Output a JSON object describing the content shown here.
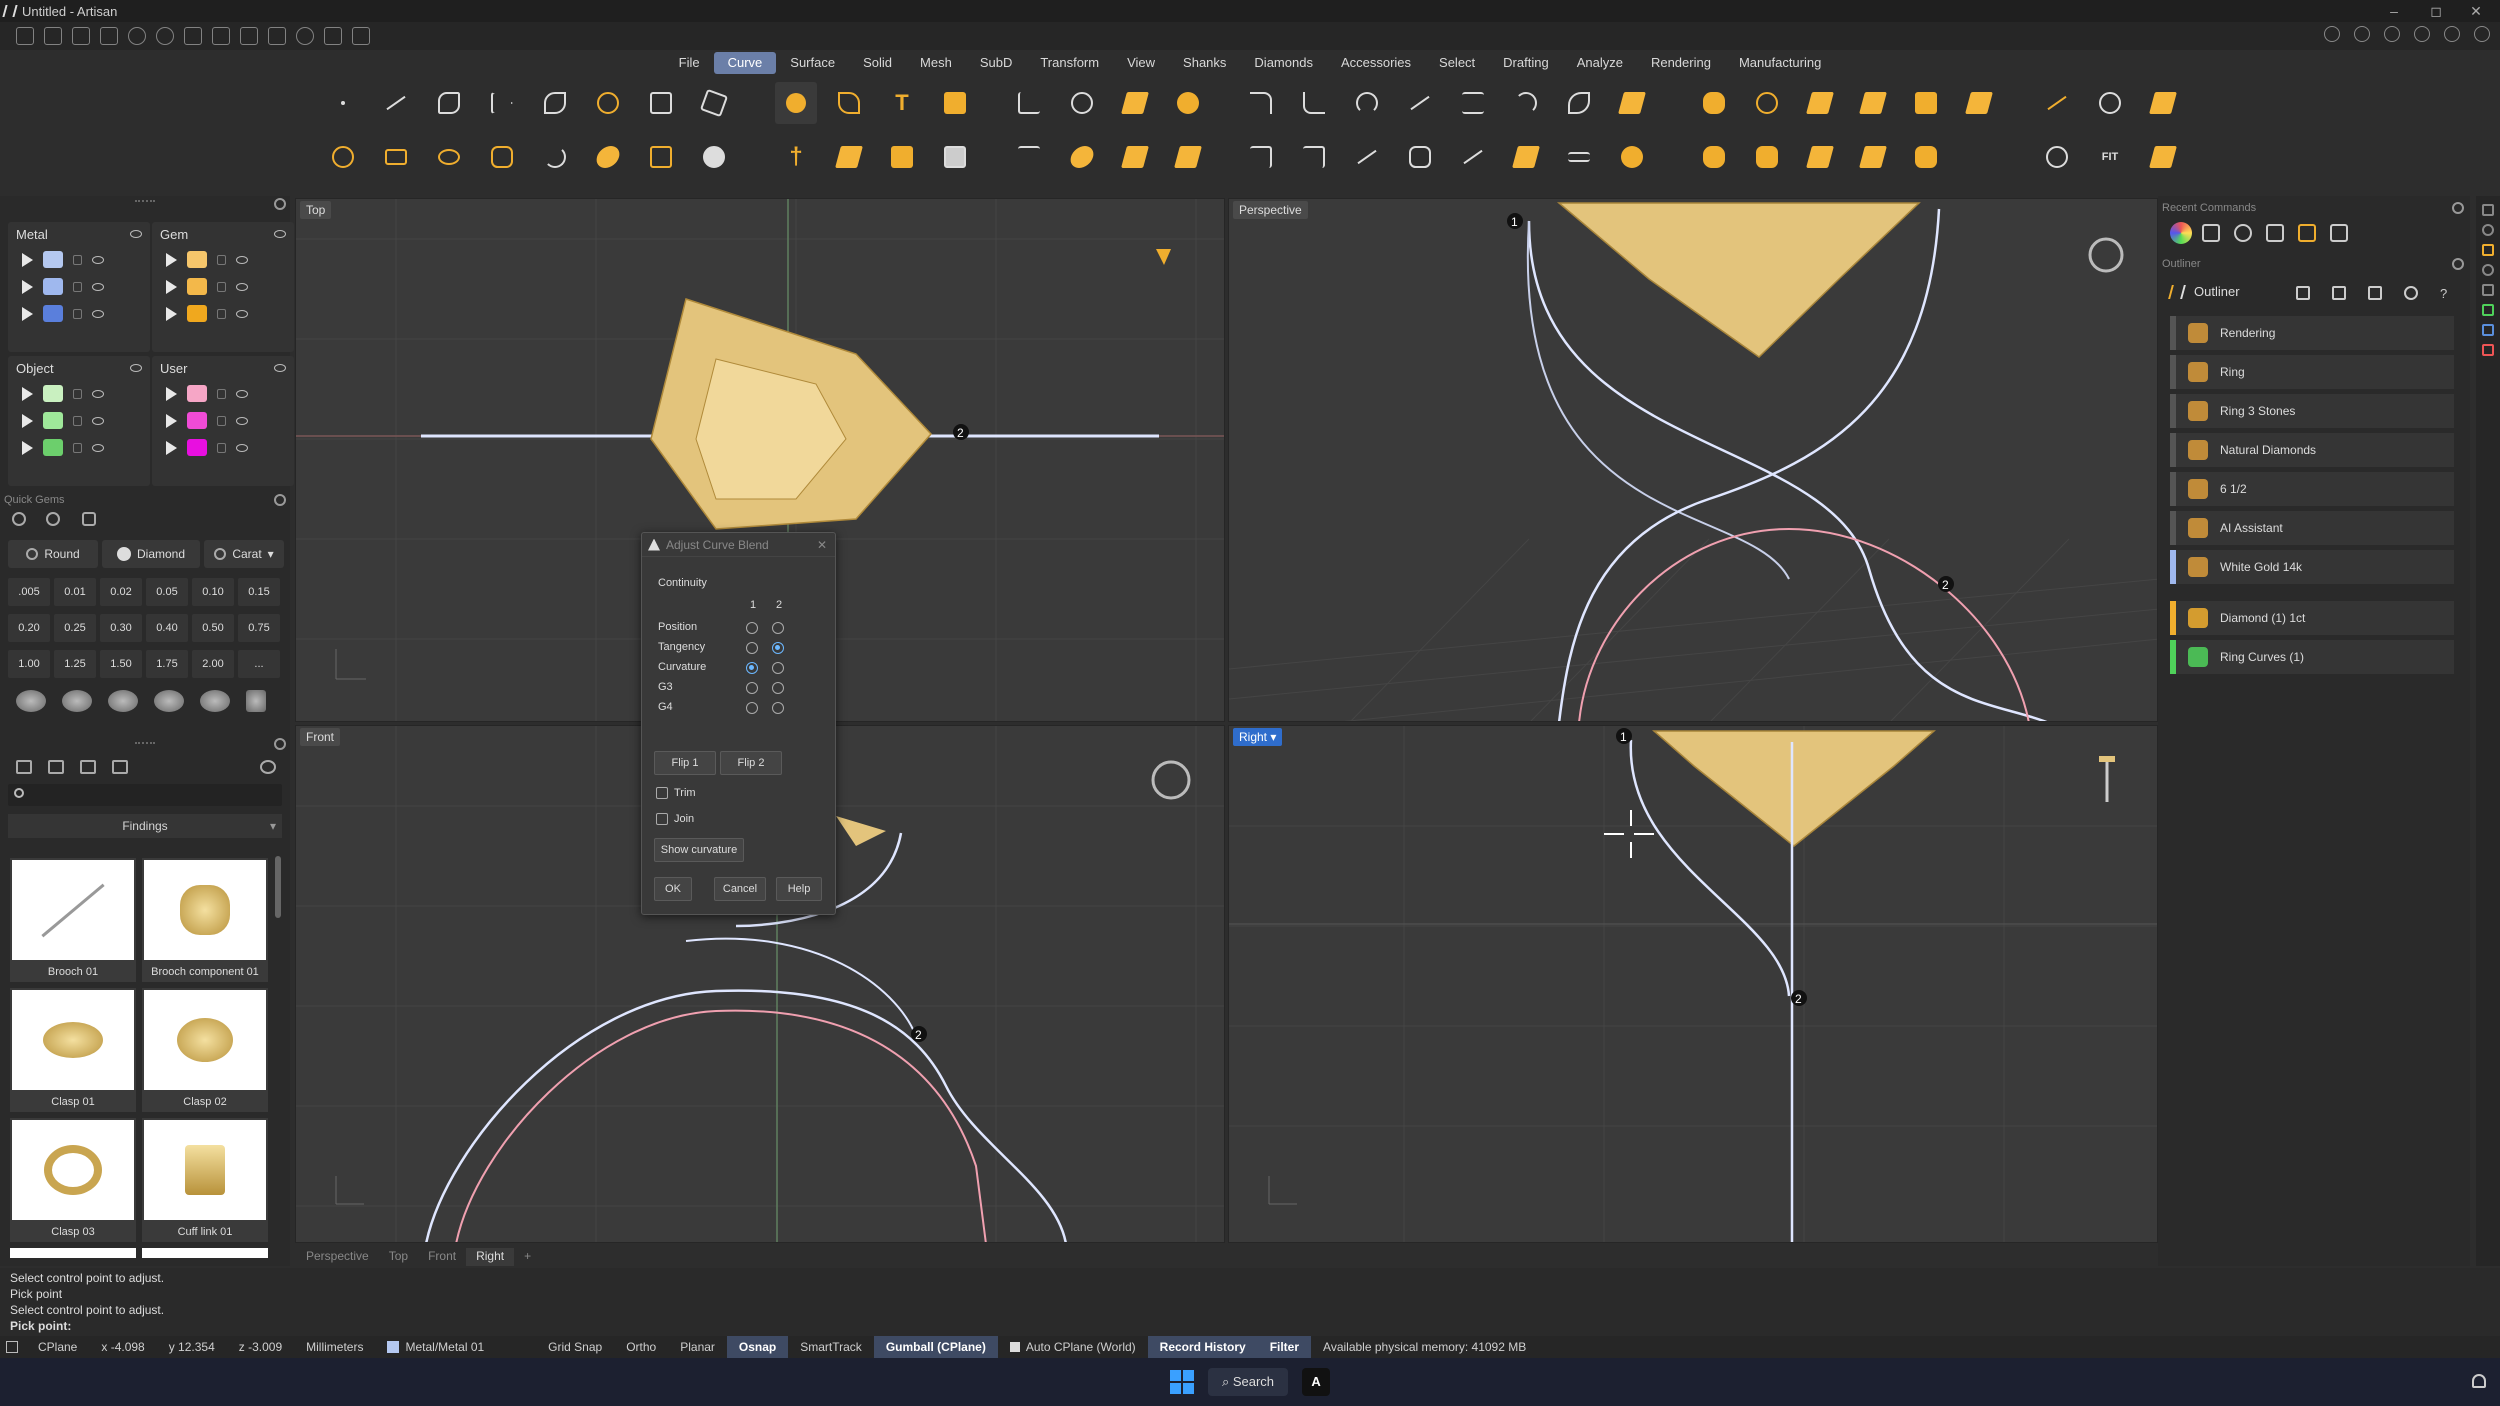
{
  "window": {
    "title": "Untitled - Artisan",
    "min": "–",
    "max": "◻",
    "close": "✕"
  },
  "menu": [
    "File",
    "Curve",
    "Surface",
    "Solid",
    "Mesh",
    "SubD",
    "Transform",
    "View",
    "Shanks",
    "Diamonds",
    "Accessories",
    "Select",
    "Drafting",
    "Analyze",
    "Rendering",
    "Manufacturing"
  ],
  "menu_active": "Curve",
  "layers": {
    "metal": {
      "label": "Metal",
      "colors": [
        "#b4c8f0",
        "#9fb8ee",
        "#5a7fdc"
      ]
    },
    "gem": {
      "label": "Gem",
      "colors": [
        "#f6c66b",
        "#f3b84a",
        "#f0a81e"
      ]
    },
    "object": {
      "label": "Object",
      "colors": [
        "#c9f0c0",
        "#9fe89a",
        "#6ccf6c"
      ]
    },
    "user": {
      "label": "User",
      "colors": [
        "#f6a6c6",
        "#f04bd6",
        "#e80fe0"
      ]
    }
  },
  "quick_gems": {
    "title": "Quick Gems",
    "shape": "Round",
    "material": "Diamond",
    "unit": "Carat",
    "sizes": [
      ".005",
      "0.01",
      "0.02",
      "0.05",
      "0.10",
      "0.15",
      "0.20",
      "0.25",
      "0.30",
      "0.40",
      "0.50",
      "0.75",
      "1.00",
      "1.25",
      "1.50",
      "1.75",
      "2.00",
      "..."
    ]
  },
  "findings": {
    "title": "Findings",
    "items": [
      "Brooch 01",
      "Brooch component 01",
      "Clasp 01",
      "Clasp 02",
      "Clasp 03",
      "Cuff link 01"
    ]
  },
  "viewports": {
    "top": "Top",
    "perspective": "Perspective",
    "front": "Front",
    "right": "Right"
  },
  "viewport_tabs": [
    "Perspective",
    "Top",
    "Front",
    "Right"
  ],
  "viewport_tab_active": "Right",
  "dialog": {
    "title": "Adjust Curve Blend",
    "section": "Continuity",
    "col1": "1",
    "col2": "2",
    "rows": [
      "Position",
      "Tangency",
      "Curvature",
      "G3",
      "G4"
    ],
    "selected_end1": "Curvature",
    "selected_end2": "Tangency",
    "flip1": "Flip 1",
    "flip2": "Flip 2",
    "trim": "Trim",
    "join": "Join",
    "show_curvature": "Show curvature",
    "ok": "OK",
    "cancel": "Cancel",
    "help": "Help"
  },
  "recent_commands": "Recent Commands",
  "outliner": {
    "title": "Outliner",
    "header": "Outliner",
    "items": [
      {
        "label": "Rendering",
        "color": "#555555"
      },
      {
        "label": "Ring",
        "color": "#555555"
      },
      {
        "label": "Ring 3 Stones",
        "color": "#555555"
      },
      {
        "label": "Natural Diamonds",
        "color": "#555555"
      },
      {
        "label": "6 1/2",
        "color": "#555555"
      },
      {
        "label": "AI Assistant",
        "color": "#555555"
      },
      {
        "label": "White Gold 14k",
        "color": "#9fb8ee"
      },
      {
        "label": "Diamond (1) 1ct",
        "color": "#f0ae2e"
      },
      {
        "label": "Ring Curves (1)",
        "color": "#4fd15a"
      }
    ]
  },
  "command_history": [
    "Select control point to adjust.",
    "Pick point",
    "Select control point to adjust."
  ],
  "command_prompt": "Pick point:",
  "status": {
    "cplane": "CPlane",
    "x": "x -4.098",
    "y": "y 12.354",
    "z": "z -3.009",
    "units": "Millimeters",
    "layer": "Metal/Metal 01",
    "grid_snap": "Grid Snap",
    "ortho": "Ortho",
    "planar": "Planar",
    "osnap": "Osnap",
    "smarttrack": "SmartTrack",
    "gumball": "Gumball (CPlane)",
    "auto_cplane": "Auto CPlane (World)",
    "record_history": "Record History",
    "filter": "Filter",
    "memory": "Available physical memory: 41092 MB"
  },
  "taskbar": {
    "search": "Search",
    "app": "A"
  },
  "point_labels": {
    "one": "1",
    "two": "2"
  }
}
